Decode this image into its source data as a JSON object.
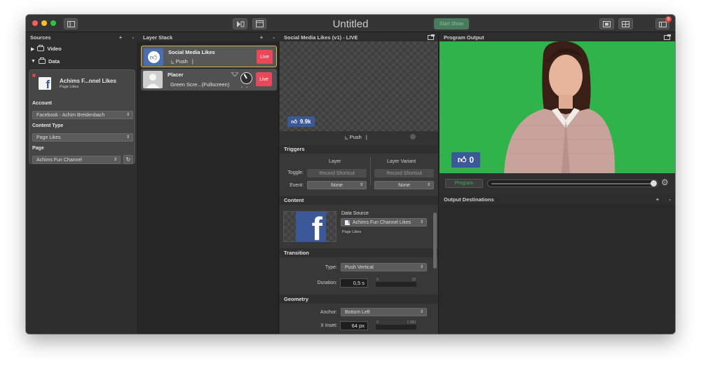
{
  "window": {
    "title": "Untitled",
    "start_show_label": "Start Show",
    "notification_count": "9"
  },
  "sources": {
    "header": "Sources",
    "add": "+",
    "remove": "-",
    "tree": [
      {
        "label": "Video",
        "expanded": false
      },
      {
        "label": "Data",
        "expanded": true
      }
    ],
    "card": {
      "title": "Achims F...nnel Likes",
      "subtitle": "Page Likes",
      "account_label": "Account",
      "account_value": "Facebook - Achim Breidenbach",
      "content_type_label": "Content Type",
      "content_type_value": "Page Likes",
      "page_label": "Page",
      "page_value": "Achims Fun Channel"
    }
  },
  "layers": {
    "header": "Layer Stack",
    "add": "+",
    "remove": "-",
    "items": [
      {
        "name": "Social Media Likes",
        "sub": "Push",
        "live_label": "Live",
        "selected": true
      },
      {
        "name": "Placer",
        "sub": "Green Scre...(Fullscreen)",
        "live_label": "Live",
        "selected": false
      }
    ]
  },
  "inspector": {
    "header": "Social Media Likes (v1) - LIVE",
    "preview_like_count": "9.9k",
    "transition_label": "Push",
    "triggers": {
      "title": "Triggers",
      "layer_col": "Layer",
      "variant_col": "Layer Variant",
      "toggle_label": "Toggle:",
      "event_label": "Event:",
      "record_shortcut": "Record Shortcut",
      "none": "None"
    },
    "content": {
      "title": "Content",
      "data_source_label": "Data Source",
      "data_source_value": "Achims Fun Channel Likes",
      "data_source_sub": "Page Likes"
    },
    "transition": {
      "title": "Transition",
      "type_label": "Type:",
      "type_value": "Push Vertical",
      "duration_label": "Duration:",
      "duration_value": "0,5 s",
      "duration_min": "0",
      "duration_max": "10"
    },
    "geometry": {
      "title": "Geometry",
      "anchor_label": "Anchor:",
      "anchor_value": "Bottom Left",
      "xinset_label": "X Inset:",
      "xinset_value": "64 px",
      "xinset_min": "0",
      "xinset_max": "1.280"
    }
  },
  "output": {
    "header": "Program Output",
    "like_count": "0",
    "program_label": "Program",
    "destinations_header": "Output Destinations",
    "add": "+",
    "remove": "-"
  },
  "colors": {
    "green_screen": "#2fb34a",
    "facebook_blue": "#3b5998",
    "live_red": "#e8485a",
    "selection_gold": "#d4b94a"
  }
}
